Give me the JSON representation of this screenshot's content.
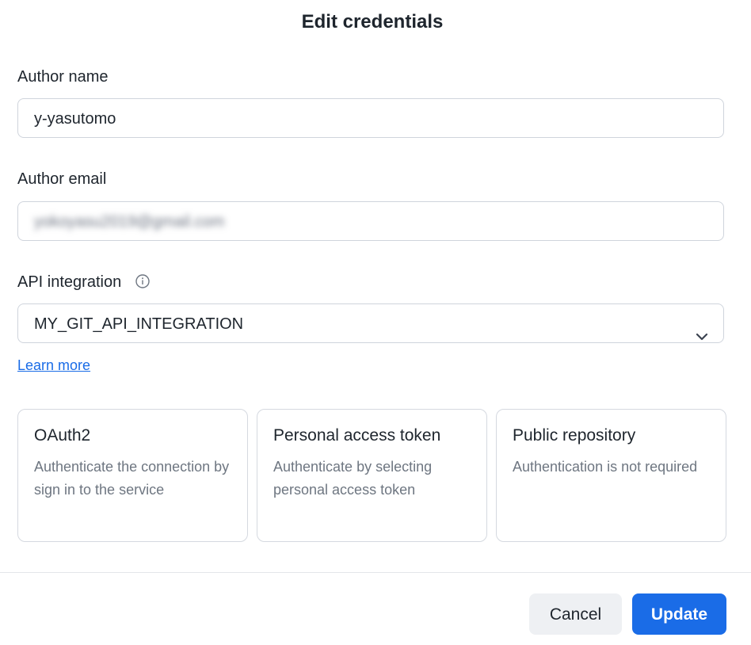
{
  "dialog": {
    "title": "Edit credentials"
  },
  "form": {
    "author_name": {
      "label": "Author name",
      "value": "y-yasutomo"
    },
    "author_email": {
      "label": "Author email",
      "value": "yokoyasu2019@gmail.com"
    },
    "api_integration": {
      "label": "API integration",
      "selected": "MY_GIT_API_INTEGRATION",
      "info_icon": "info-icon",
      "chevron_icon": "chevron-down-icon"
    },
    "learn_more": "Learn more"
  },
  "auth_options": [
    {
      "title": "OAuth2",
      "description": "Authenticate the connection by sign in to the service"
    },
    {
      "title": "Personal access token",
      "description": "Authenticate by selecting personal access token"
    },
    {
      "title": "Public repository",
      "description": "Authentication is not required"
    }
  ],
  "footer": {
    "cancel_label": "Cancel",
    "update_label": "Update"
  },
  "colors": {
    "accent": "#1a6ce7",
    "text": "#1e252d",
    "muted": "#6e7681",
    "border": "#cfd4dc"
  }
}
